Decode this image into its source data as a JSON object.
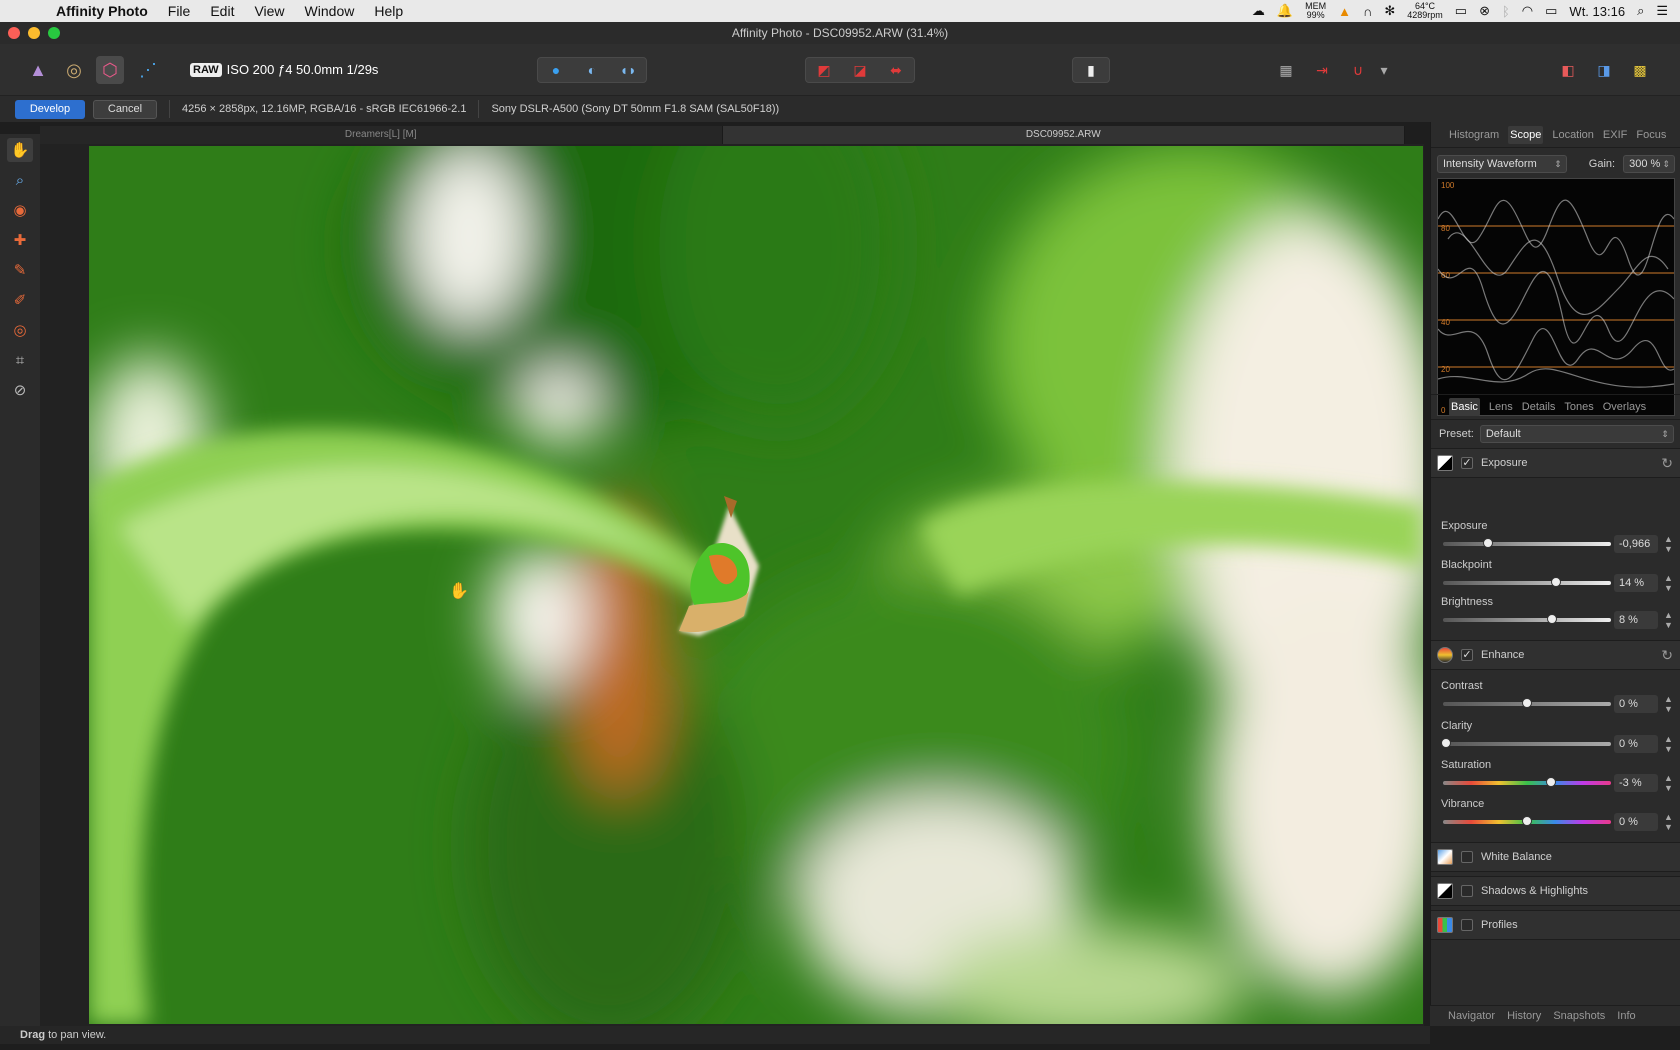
{
  "menubar": {
    "app_name": "Affinity Photo",
    "items": [
      "File",
      "Edit",
      "View",
      "Window",
      "Help"
    ],
    "status": {
      "mem_label": "MEM",
      "mem_value": "99%",
      "temp": "64°C",
      "rpm": "4289rpm",
      "clock": "Wt. 13:16"
    }
  },
  "window": {
    "title": "Affinity Photo - DSC09952.ARW (31.4%)"
  },
  "toolbar": {
    "raw_badge": "RAW",
    "shot_info": "ISO 200 ƒ4 50.0mm 1/29s"
  },
  "context": {
    "develop_label": "Develop",
    "cancel_label": "Cancel",
    "image_info": "4256 × 2858px, 12.16MP, RGBA/16 - sRGB IEC61966-2.1",
    "camera_info": "Sony DSLR-A500 (Sony DT 50mm F1.8 SAM (SAL50F18))"
  },
  "doc_tabs": [
    {
      "label": "Dreamers[L] [M]"
    },
    {
      "label": "DSC09952.ARW"
    }
  ],
  "status_bar": {
    "bold": "Drag",
    "text": " to pan view."
  },
  "panel": {
    "top_tabs": [
      "Histogram",
      "Scope",
      "Location",
      "EXIF",
      "Focus"
    ],
    "scope_mode": "Intensity Waveform",
    "gain_label": "Gain:",
    "gain_value": "300 %",
    "scope_scale": [
      "100",
      "80",
      "60",
      "40",
      "20",
      "0"
    ],
    "dev_tabs": [
      "Basic",
      "Lens",
      "Details",
      "Tones",
      "Overlays"
    ],
    "preset_label": "Preset:",
    "preset_value": "Default",
    "exposure_section": "Exposure",
    "exposure": {
      "label": "Exposure",
      "value": "-0,966",
      "pos": 0.27
    },
    "blackpoint": {
      "label": "Blackpoint",
      "value": "14 %",
      "pos": 0.67
    },
    "brightness": {
      "label": "Brightness",
      "value": "8 %",
      "pos": 0.65
    },
    "enhance_section": "Enhance",
    "contrast": {
      "label": "Contrast",
      "value": "0 %",
      "pos": 0.5
    },
    "clarity": {
      "label": "Clarity",
      "value": "0 %",
      "pos": 0.02
    },
    "saturation": {
      "label": "Saturation",
      "value": "-3 %",
      "pos": 0.64
    },
    "vibrance": {
      "label": "Vibrance",
      "value": "0 %",
      "pos": 0.5
    },
    "white_balance": "White Balance",
    "shadows_highlights": "Shadows & Highlights",
    "profiles": "Profiles",
    "bottom_tabs": [
      "Navigator",
      "History",
      "Snapshots",
      "Info"
    ]
  },
  "colors": {
    "accent": "#2d6fcf",
    "scope_line": "#d07a2a",
    "tool_orange": "#e86a3a"
  }
}
